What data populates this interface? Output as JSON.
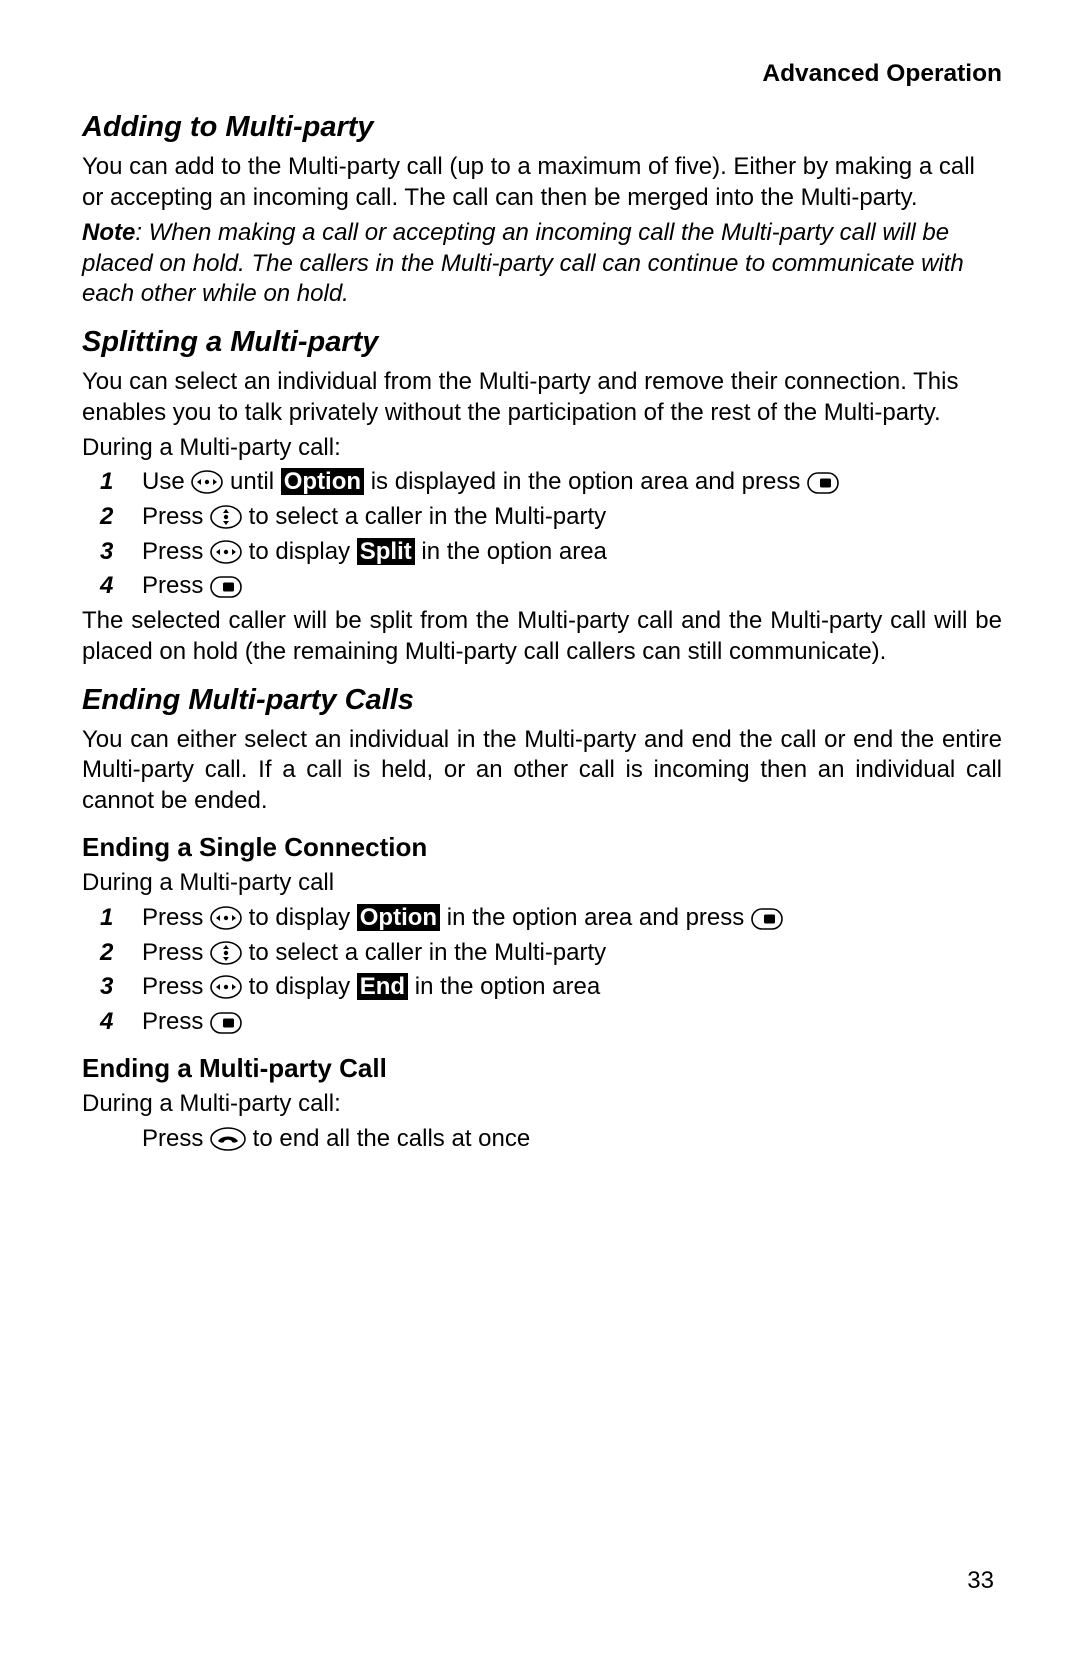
{
  "header": {
    "right": "Advanced Operation"
  },
  "pagenum": "33",
  "labels": {
    "option": "Option",
    "split": "Split",
    "end": "End",
    "note_lead": "Note"
  },
  "sec1": {
    "title": "Adding to Multi-party",
    "p1": "You can add to the Multi-party call (up to a maximum of five). Either by making a call or accepting an incoming call. The call can then be merged into the Multi-party.",
    "note_rest": ": When making a call or accepting an incoming call the Multi-party call will be placed on hold. The callers in the Multi-party call can continue to communicate with each other while on hold."
  },
  "sec2": {
    "title": "Splitting a Multi-party",
    "p1": "You can select an individual from the Multi-party and remove their connection. This enables you to talk privately without the participation of the rest of the Multi-party.",
    "p2": "During a Multi-party call:",
    "s1a": "Use ",
    "s1b": " until ",
    "s1c": " is displayed in the option area and press ",
    "s2a": "Press ",
    "s2b": " to select a caller in the Multi-party",
    "s3a": "Press ",
    "s3b": " to display ",
    "s3c": " in the option area",
    "s4a": "Press ",
    "p3": "The selected caller will be split from the Multi-party call and the Multi-party call will be placed on hold (the remaining Multi-party call callers can still communicate)."
  },
  "sec3": {
    "title": "Ending Multi-party Calls",
    "p1": "You can either select an individual in the Multi-party and end the call or end the entire Multi-party call. If a call is held, or an other call is incoming then an individual call cannot be ended.",
    "sub1": {
      "title": "Ending a Single Connection",
      "p1": "During a Multi-party call",
      "s1a": "Press ",
      "s1b": " to display ",
      "s1c": " in the option area and press ",
      "s2a": "Press ",
      "s2b": " to select a caller in the Multi-party",
      "s3a": "Press ",
      "s3b": " to display ",
      "s3c": " in the option area",
      "s4a": "Press "
    },
    "sub2": {
      "title": "Ending a Multi-party Call",
      "p1": "During a Multi-party call:",
      "line_a": "Press ",
      "line_b": " to end all the calls at once"
    }
  },
  "nums": {
    "1": "1",
    "2": "2",
    "3": "3",
    "4": "4"
  }
}
